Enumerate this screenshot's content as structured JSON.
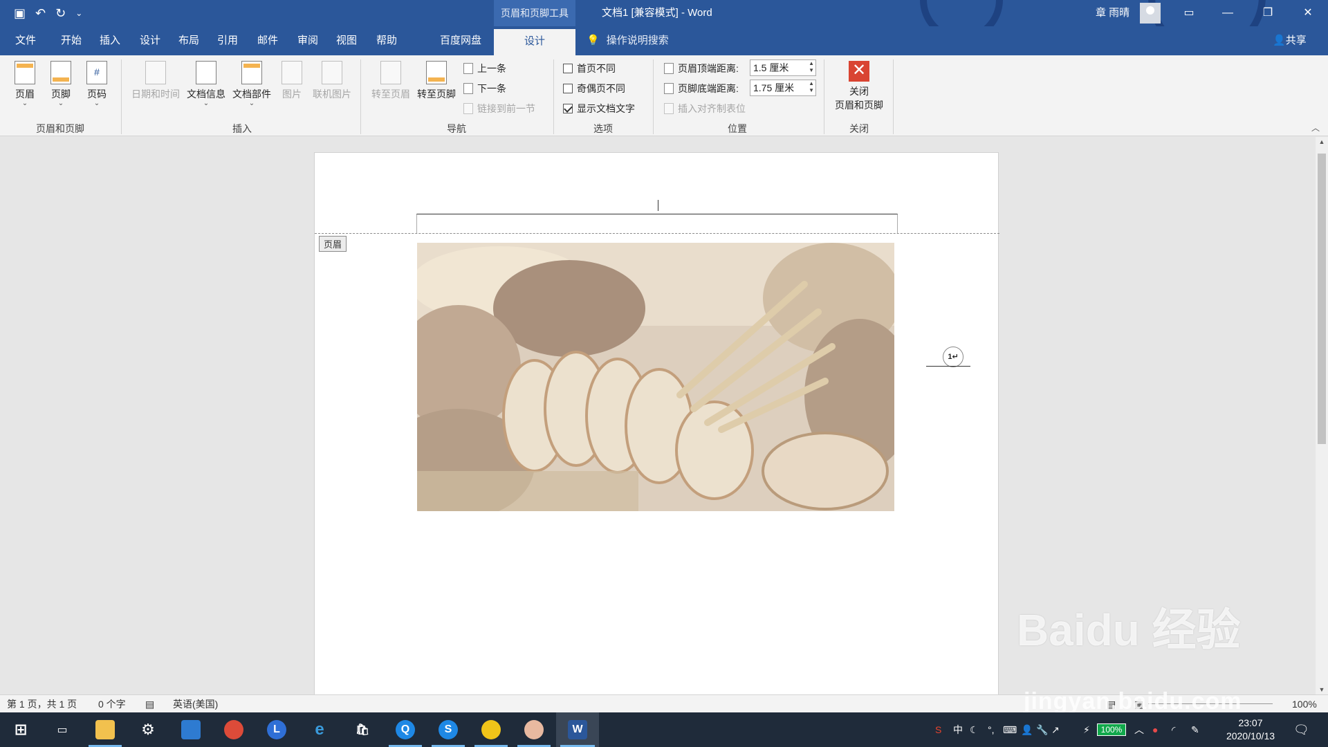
{
  "titlebar": {
    "context_tab": "页眉和页脚工具",
    "doc_title": "文档1 [兼容模式]  -  Word",
    "user": "章 雨晴",
    "qat_icons": [
      "save-icon",
      "undo-icon",
      "redo-icon",
      "customize-icon"
    ]
  },
  "tabs": {
    "items": [
      "文件",
      "开始",
      "插入",
      "设计",
      "布局",
      "引用",
      "邮件",
      "审阅",
      "视图",
      "帮助",
      "百度网盘",
      "设计"
    ],
    "active_index": 11,
    "search": "操作说明搜索",
    "share": "共享"
  },
  "ribbon": {
    "group_header_footer": {
      "label": "页眉和页脚",
      "header": "页眉",
      "footer": "页脚",
      "page_number": "页码"
    },
    "group_insert": {
      "label": "插入",
      "date_time": "日期和时间",
      "doc_info": "文档信息",
      "doc_parts": "文档部件",
      "picture": "图片",
      "online_picture": "联机图片"
    },
    "group_nav": {
      "label": "导航",
      "goto_header": "转至页眉",
      "goto_footer": "转至页脚",
      "prev": "上一条",
      "next": "下一条",
      "link_prev": "链接到前一节"
    },
    "group_options": {
      "label": "选项",
      "different_first": "首页不同",
      "different_odd_even": "奇偶页不同",
      "show_doc_text": "显示文档文字"
    },
    "group_position": {
      "label": "位置",
      "header_top_label": "页眉顶端距离:",
      "header_top_value": "1.5 厘米",
      "footer_bottom_label": "页脚底端距离:",
      "footer_bottom_value": "1.75 厘米",
      "insert_align_tab": "插入对齐制表位"
    },
    "group_close": {
      "label": "关闭",
      "close_line1": "关闭",
      "close_line2": "页眉和页脚"
    }
  },
  "document": {
    "header_tag": "页眉",
    "page_number": "1↵",
    "image_name": "bread-and-wheat-photo"
  },
  "statusbar": {
    "page": "第 1 页，共 1 页",
    "words": "0 个字",
    "language": "英语(美国)",
    "zoom": "100%"
  },
  "taskbar": {
    "ime": "中",
    "battery": "100%",
    "time": "23:07",
    "date": "2020/10/13"
  },
  "watermark": {
    "line1": "Baidu 经验",
    "line2": "jingyan.baidu.com"
  },
  "colors": {
    "word_blue": "#2b579a",
    "ribbon_bg": "#f3f3f3",
    "taskbar": "#1f2b3a",
    "close_red": "#d94432"
  }
}
